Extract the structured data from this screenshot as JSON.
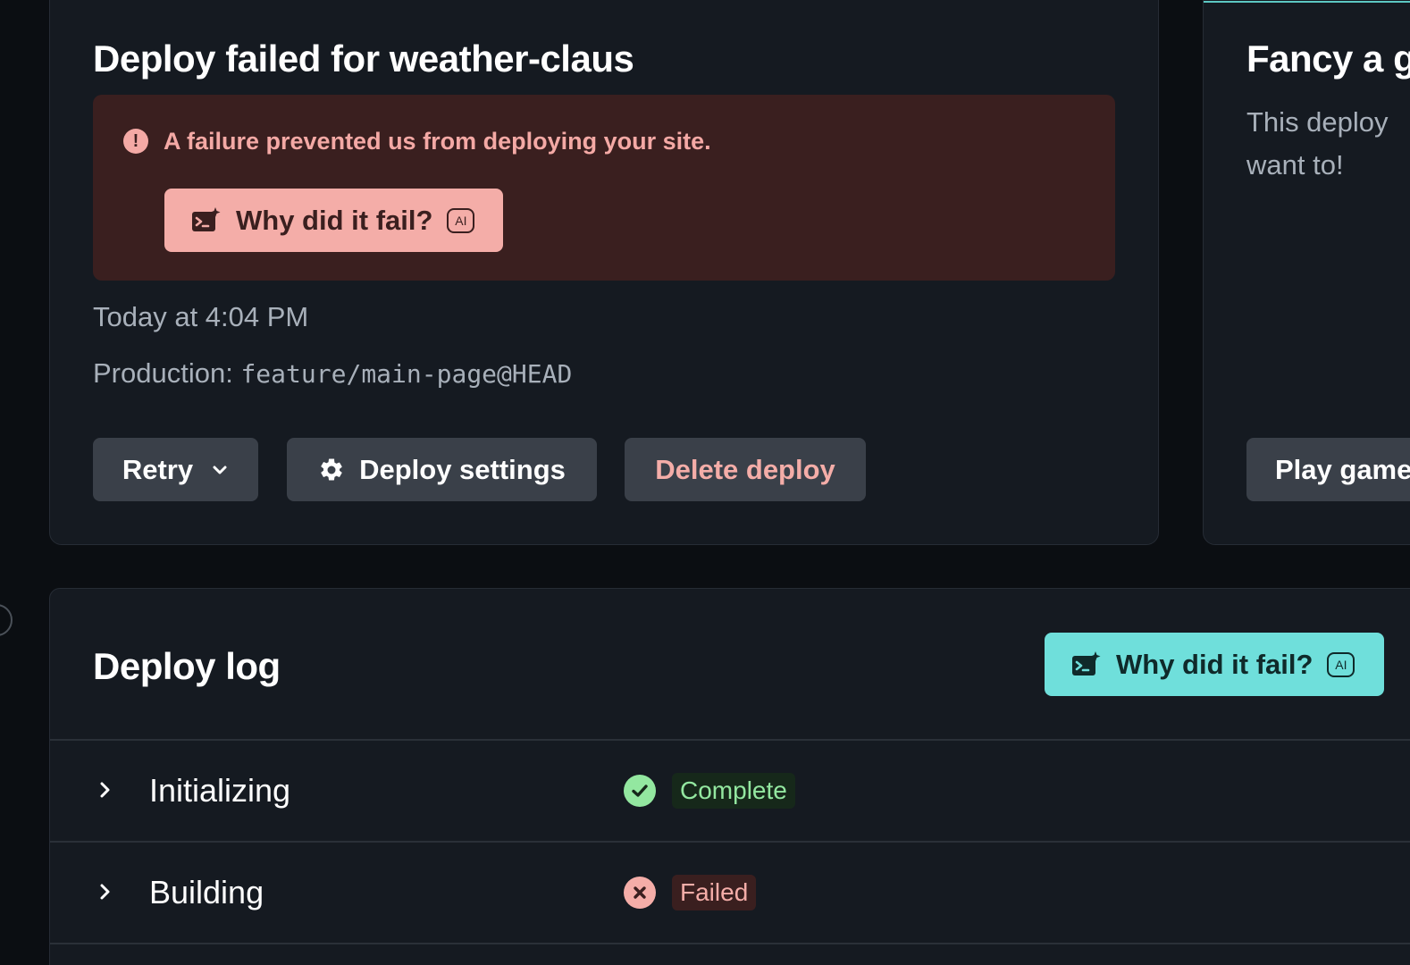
{
  "deploy_card": {
    "title": "Deploy failed for weather-claus",
    "alert": {
      "message": "A failure prevented us from deploying your site.",
      "ai_button_label": "Why did it fail?",
      "ai_badge": "AI"
    },
    "timestamp": "Today at 4:04 PM",
    "production_label": "Production:",
    "production_ref": "feature/main-page@HEAD",
    "actions": {
      "retry_label": "Retry",
      "deploy_settings_label": "Deploy settings",
      "delete_deploy_label": "Delete deploy"
    }
  },
  "game_card": {
    "title": "Fancy a g",
    "text_line1": "This deploy",
    "text_line2": "want to!",
    "play_button_label": "Play game"
  },
  "deploy_log": {
    "title": "Deploy log",
    "ai_button_label": "Why did it fail?",
    "ai_badge": "AI",
    "rows": [
      {
        "label": "Initializing",
        "status": "Complete"
      },
      {
        "label": "Building",
        "status": "Failed"
      }
    ]
  },
  "colors": {
    "background": "#0b0e12",
    "card": "#151a21",
    "alert_bg": "#3a1f1f",
    "alert_text": "#f4a9a5",
    "accent_teal": "#6fdfdb",
    "success": "#93e7a0",
    "button_bg": "#3a4049"
  },
  "icons": {
    "alert": "exclamation-circle-icon",
    "ai": "terminal-sparkle-icon",
    "retry_dropdown": "chevron-down-icon",
    "settings": "gear-icon",
    "row_expand": "chevron-right-icon",
    "complete": "check-circle-icon",
    "failed": "x-circle-icon"
  }
}
